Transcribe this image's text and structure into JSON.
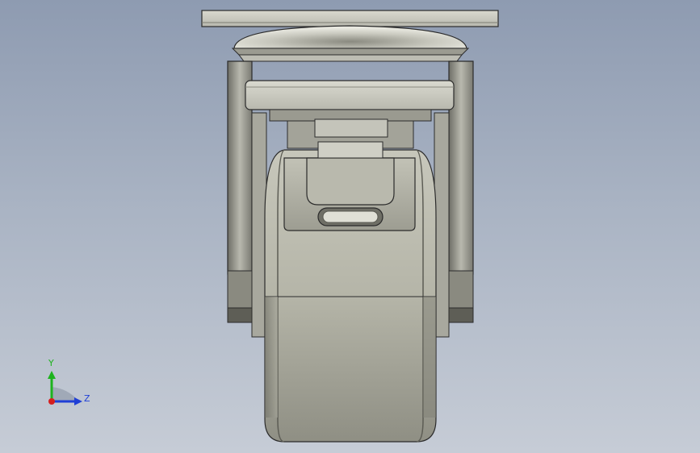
{
  "viewport": {
    "background_top": "#8e9bb1",
    "background_bottom": "#c6ccd6",
    "model_name": "caster-wheel-assembly"
  },
  "triad": {
    "y_label": "Y",
    "z_label": "Z",
    "colors": {
      "y": "#1db31d",
      "z": "#1f3fd6",
      "x": "#d61f1f",
      "plane": "#9aa3b3"
    }
  }
}
